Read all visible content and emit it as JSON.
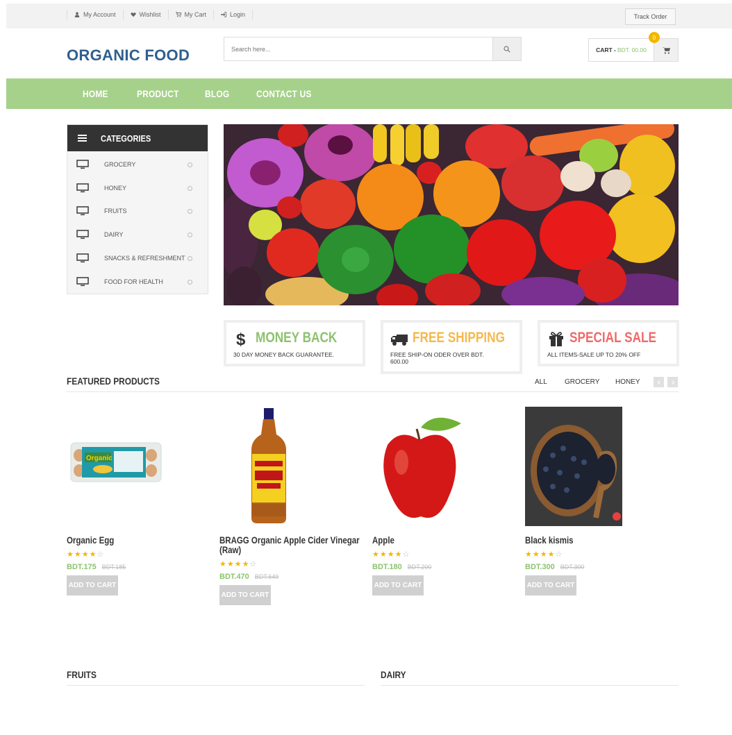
{
  "topbar": {
    "links": [
      {
        "label": "My Account",
        "icon": "user-icon"
      },
      {
        "label": "Wishlist",
        "icon": "heart-icon"
      },
      {
        "label": "My Cart",
        "icon": "cart-icon"
      },
      {
        "label": "Login",
        "icon": "login-icon"
      }
    ],
    "track_order": "Track Order"
  },
  "header": {
    "logo": "ORGANIC FOOD",
    "search_placeholder": "Search here...",
    "cart_label": "CART -",
    "cart_amount": "BDT. 00.00",
    "cart_count": "0"
  },
  "nav": [
    "HOME",
    "PRODUCT",
    "BLOG",
    "CONTACT US"
  ],
  "categories": {
    "title": "CATEGORIES",
    "items": [
      "GROCERY",
      "HONEY",
      "FRUITS",
      "DAIRY",
      "SNACKS & REFRESHMENT",
      "FOOD FOR HEALTH"
    ]
  },
  "features": [
    {
      "title": "MONEY BACK",
      "subtitle": "30 DAY MONEY BACK GUARANTEE.",
      "color": "#8dc26f",
      "icon": "dollar-icon"
    },
    {
      "title": "FREE SHIPPING",
      "subtitle": "FREE SHIP-ON ODER OVER BDT. 600.00",
      "color": "#f7b84b",
      "icon": "truck-icon"
    },
    {
      "title": "SPECIAL SALE",
      "subtitle": "ALL ITEMS-SALE UP TO 20% OFF",
      "color": "#f06a6a",
      "icon": "gift-icon"
    }
  ],
  "featured": {
    "title": "FEATURED PRODUCTS",
    "filters": [
      "ALL",
      "GROCERY",
      "HONEY"
    ]
  },
  "products": [
    {
      "name": "Organic Egg",
      "price": "BDT.175",
      "old_price": "BDT.185",
      "rating": 4,
      "add_label": "ADD TO CART"
    },
    {
      "name": "BRAGG Organic Apple Cider Vinegar (Raw)",
      "price": "BDT.470",
      "old_price": "BDT.649",
      "rating": 4,
      "add_label": "ADD TO CART"
    },
    {
      "name": "Apple",
      "price": "BDT.180",
      "old_price": "BDT.200",
      "rating": 4,
      "add_label": "ADD TO CART"
    },
    {
      "name": "Black kismis",
      "price": "BDT.300",
      "old_price": "BDT.300",
      "rating": 4,
      "add_label": "ADD TO CART"
    }
  ],
  "sections": {
    "fruits": "FRUITS",
    "dairy": "DAIRY"
  },
  "colors": {
    "accent_green": "#8dc26f",
    "nav_green": "#a6d18a",
    "logo_blue": "#2f5f8f",
    "badge_yellow": "#f0b800"
  }
}
